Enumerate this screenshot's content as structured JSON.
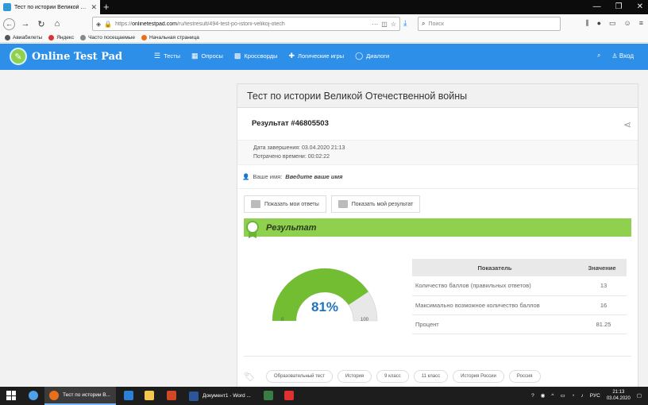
{
  "browser": {
    "tab_title": "Тест по истории Великой Оте",
    "url_host": "onlinetestpad.com",
    "url_prefix": "https://",
    "url_path": "/ru/testresult/494-test-po-istorii-velikoj-otech",
    "search_placeholder": "Поиск",
    "bookmarks": [
      "Авиабилеты",
      "Яндекс",
      "Часто посещаемые",
      "Начальная страница"
    ]
  },
  "site": {
    "logo_text": "Online Test Pad",
    "menu": [
      "Тесты",
      "Опросы",
      "Кроссворды",
      "Логические игры",
      "Диалоги"
    ],
    "login_label": "Вход"
  },
  "card": {
    "title": "Тест по истории Великой Отечественной войны",
    "result_number": "Результат #46805503",
    "finish_label": "Дата завершения:",
    "finish_value": "03.04.2020 21:13",
    "time_label": "Потрачено времени:",
    "time_value": "00:02:22",
    "name_label": "Ваше имя:",
    "name_value": "Введите ваше имя",
    "show_answers": "Показать мои ответы",
    "show_result": "Показать мой результат",
    "result_heading": "Результат"
  },
  "gauge": {
    "percent_label": "81%",
    "min": "0",
    "max": "100",
    "fill_fraction": 0.8125,
    "fill_color": "#72bd32",
    "track_color": "#e8e8e8"
  },
  "results_table": {
    "col_indicator": "Показатель",
    "col_value": "Значение",
    "rows": [
      {
        "label": "Количество баллов (правильных ответов)",
        "value": "13"
      },
      {
        "label": "Максимально возможное количество баллов",
        "value": "16"
      },
      {
        "label": "Процент",
        "value": "81.25"
      }
    ]
  },
  "tags": [
    "Образовательный тест",
    "История",
    "9 класс",
    "11 класс",
    "История России",
    "Россия"
  ],
  "taskbar": {
    "firefox_task": "Тест по истории В...",
    "word_task": "Документ1 - Word ...",
    "lang": "РУС",
    "time": "21:13",
    "date": "03.04.2020"
  },
  "colors": {
    "header_blue": "#2e8fe8",
    "result_green": "#8fd14f"
  }
}
